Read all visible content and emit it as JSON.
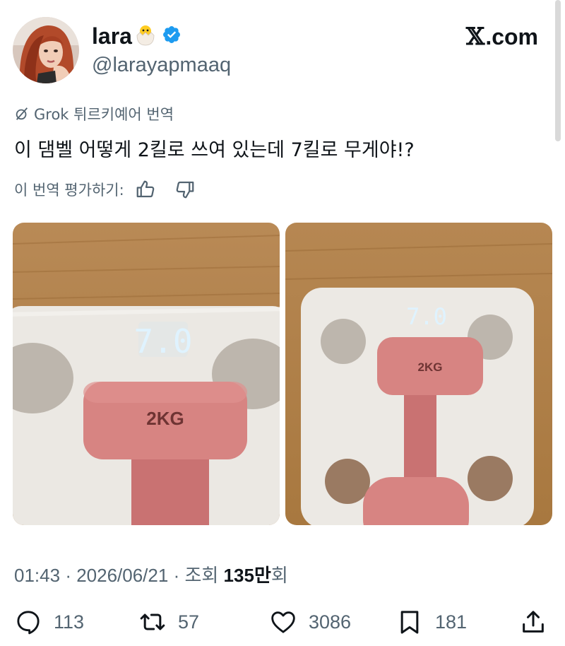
{
  "author": {
    "display_name": "lara",
    "handle": "@larayapmaaq",
    "verified": true,
    "name_emoji": "hatching-chick-icon"
  },
  "site": {
    "logo_text": ".com",
    "logo_glyph": "𝕏"
  },
  "translation": {
    "label": "Grok 튀르키예어 번역",
    "text": "이 댐벨 어떻게 2킬로 쓰여 있는데 7킬로 무게야!?",
    "rate_prompt": "이 번역 평가하기:"
  },
  "photos": [
    {
      "scale_reading": "7.0",
      "dumbbell_label": "2KG"
    },
    {
      "scale_reading": "7.0",
      "dumbbell_label": "2KG"
    }
  ],
  "meta": {
    "time": "01:43",
    "date": "2026/06/21",
    "views_label": "조회",
    "views_number": "135",
    "views_unit": "만",
    "views_suffix": "회"
  },
  "actions": {
    "replies": "113",
    "retweets": "57",
    "likes": "3086",
    "bookmarks": "181"
  },
  "colors": {
    "text": "#0f1419",
    "secondary": "#536471",
    "verified": "#1d9bf0"
  }
}
